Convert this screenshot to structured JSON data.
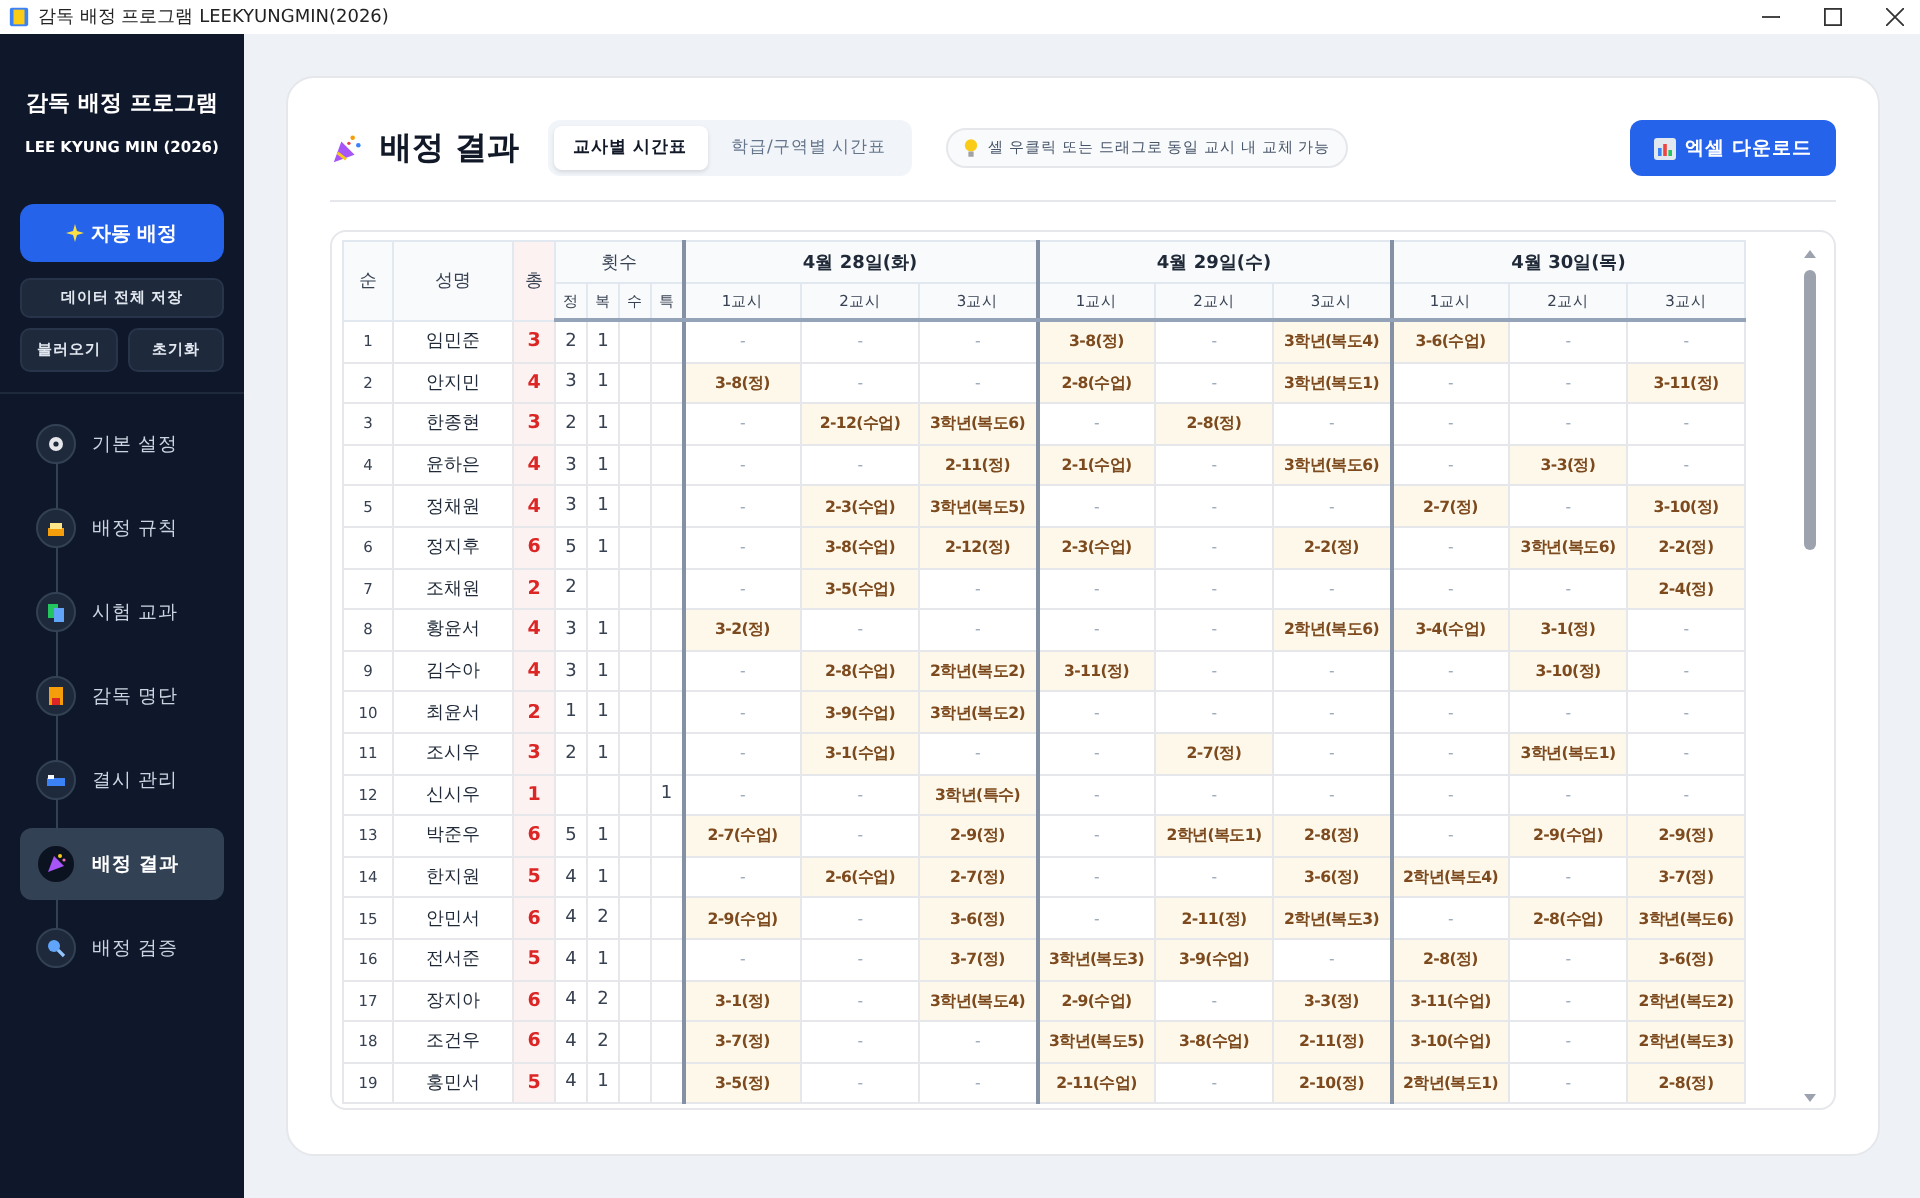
{
  "window": {
    "title": "감독 배정 프로그램 LEEKYUNGMIN(2026)"
  },
  "sidebar": {
    "title": "감독 배정 프로그램",
    "subtitle": "LEE KYUNG MIN (2026)",
    "primary_button": "자동 배정",
    "save_button": "데이터 전체 저장",
    "load_button": "불러오기",
    "reset_button": "초기화",
    "nav": [
      {
        "label": "기본 설정",
        "selected": false
      },
      {
        "label": "배정 규칙",
        "selected": false
      },
      {
        "label": "시험 교과",
        "selected": false
      },
      {
        "label": "감독 명단",
        "selected": false
      },
      {
        "label": "결시 관리",
        "selected": false
      },
      {
        "label": "배정 결과",
        "selected": true
      },
      {
        "label": "배정 검증",
        "selected": false
      }
    ]
  },
  "page": {
    "title": "배정 결과",
    "tabs": [
      {
        "label": "교사별 시간표",
        "selected": true
      },
      {
        "label": "학급/구역별 시간표",
        "selected": false
      }
    ],
    "hint": "셀 우클릭 또는 드래그로 동일 교시 내 교체 가능",
    "export_button": "엑셀 다운로드"
  },
  "table": {
    "columns": {
      "no": "순",
      "name": "성명",
      "total": "총",
      "count_group": "횟수",
      "count_types": [
        "정",
        "복",
        "수",
        "특"
      ]
    },
    "days": [
      {
        "label": "4월 28일(화)",
        "periods": [
          "1교시",
          "2교시",
          "3교시"
        ]
      },
      {
        "label": "4월 29일(수)",
        "periods": [
          "1교시",
          "2교시",
          "3교시"
        ]
      },
      {
        "label": "4월 30일(목)",
        "periods": [
          "1교시",
          "2교시",
          "3교시"
        ]
      }
    ],
    "rows": [
      {
        "no": "1",
        "name": "임민준",
        "total": "3",
        "counts": {
          "count_1": "2",
          "count_2": "1"
        },
        "cells": [
          {
            "text": "-",
            "assigned": false
          },
          {
            "text": "-",
            "assigned": false
          },
          {
            "text": "-",
            "assigned": false
          },
          {
            "text": "3-8(정)",
            "assigned": true
          },
          {
            "text": "-",
            "assigned": false
          },
          {
            "text": "3학년(복도4)",
            "assigned": true
          },
          {
            "text": "3-6(수업)",
            "assigned": true
          },
          {
            "text": "-",
            "assigned": false
          },
          {
            "text": "-",
            "assigned": false
          }
        ]
      },
      {
        "no": "2",
        "name": "안지민",
        "total": "4",
        "counts": {
          "count_1": "3",
          "count_2": "1"
        },
        "cells": [
          {
            "text": "3-8(정)",
            "assigned": true
          },
          {
            "text": "-",
            "assigned": false
          },
          {
            "text": "-",
            "assigned": false
          },
          {
            "text": "2-8(수업)",
            "assigned": true
          },
          {
            "text": "-",
            "assigned": false
          },
          {
            "text": "3학년(복도1)",
            "assigned": true
          },
          {
            "text": "-",
            "assigned": false
          },
          {
            "text": "-",
            "assigned": false
          },
          {
            "text": "3-11(정)",
            "assigned": true
          }
        ]
      },
      {
        "no": "3",
        "name": "한종현",
        "total": "3",
        "counts": {
          "count_1": "2",
          "count_2": "1"
        },
        "cells": [
          {
            "text": "-",
            "assigned": false
          },
          {
            "text": "2-12(수업)",
            "assigned": true
          },
          {
            "text": "3학년(복도6)",
            "assigned": true
          },
          {
            "text": "-",
            "assigned": false
          },
          {
            "text": "2-8(정)",
            "assigned": true
          },
          {
            "text": "-",
            "assigned": false
          },
          {
            "text": "-",
            "assigned": false
          },
          {
            "text": "-",
            "assigned": false
          },
          {
            "text": "-",
            "assigned": false
          }
        ]
      },
      {
        "no": "4",
        "name": "윤하은",
        "total": "4",
        "counts": {
          "count_1": "3",
          "count_2": "1"
        },
        "cells": [
          {
            "text": "-",
            "assigned": false
          },
          {
            "text": "-",
            "assigned": false
          },
          {
            "text": "2-11(정)",
            "assigned": true
          },
          {
            "text": "2-1(수업)",
            "assigned": true
          },
          {
            "text": "-",
            "assigned": false
          },
          {
            "text": "3학년(복도6)",
            "assigned": true
          },
          {
            "text": "-",
            "assigned": false
          },
          {
            "text": "3-3(정)",
            "assigned": true
          },
          {
            "text": "-",
            "assigned": false
          }
        ]
      },
      {
        "no": "5",
        "name": "정채원",
        "total": "4",
        "counts": {
          "count_1": "3",
          "count_2": "1"
        },
        "cells": [
          {
            "text": "-",
            "assigned": false
          },
          {
            "text": "2-3(수업)",
            "assigned": true
          },
          {
            "text": "3학년(복도5)",
            "assigned": true
          },
          {
            "text": "-",
            "assigned": false
          },
          {
            "text": "-",
            "assigned": false
          },
          {
            "text": "-",
            "assigned": false
          },
          {
            "text": "2-7(정)",
            "assigned": true
          },
          {
            "text": "-",
            "assigned": false
          },
          {
            "text": "3-10(정)",
            "assigned": true
          }
        ]
      },
      {
        "no": "6",
        "name": "정지후",
        "total": "6",
        "counts": {
          "count_1": "5",
          "count_2": "1"
        },
        "cells": [
          {
            "text": "-",
            "assigned": false
          },
          {
            "text": "3-8(수업)",
            "assigned": true
          },
          {
            "text": "2-12(정)",
            "assigned": true
          },
          {
            "text": "2-3(수업)",
            "assigned": true
          },
          {
            "text": "-",
            "assigned": false
          },
          {
            "text": "2-2(정)",
            "assigned": true
          },
          {
            "text": "-",
            "assigned": false
          },
          {
            "text": "3학년(복도6)",
            "assigned": true
          },
          {
            "text": "2-2(정)",
            "assigned": true
          }
        ]
      },
      {
        "no": "7",
        "name": "조채원",
        "total": "2",
        "counts": {
          "count_1": "2"
        },
        "cells": [
          {
            "text": "-",
            "assigned": false
          },
          {
            "text": "3-5(수업)",
            "assigned": true
          },
          {
            "text": "-",
            "assigned": false
          },
          {
            "text": "-",
            "assigned": false
          },
          {
            "text": "-",
            "assigned": false
          },
          {
            "text": "-",
            "assigned": false
          },
          {
            "text": "-",
            "assigned": false
          },
          {
            "text": "-",
            "assigned": false
          },
          {
            "text": "2-4(정)",
            "assigned": true
          }
        ]
      },
      {
        "no": "8",
        "name": "황윤서",
        "total": "4",
        "counts": {
          "count_1": "3",
          "count_2": "1"
        },
        "cells": [
          {
            "text": "3-2(정)",
            "assigned": true
          },
          {
            "text": "-",
            "assigned": false
          },
          {
            "text": "-",
            "assigned": false
          },
          {
            "text": "-",
            "assigned": false
          },
          {
            "text": "-",
            "assigned": false
          },
          {
            "text": "2학년(복도6)",
            "assigned": true
          },
          {
            "text": "3-4(수업)",
            "assigned": true
          },
          {
            "text": "3-1(정)",
            "assigned": true
          },
          {
            "text": "-",
            "assigned": false
          }
        ]
      },
      {
        "no": "9",
        "name": "김수아",
        "total": "4",
        "counts": {
          "count_1": "3",
          "count_2": "1"
        },
        "cells": [
          {
            "text": "-",
            "assigned": false
          },
          {
            "text": "2-8(수업)",
            "assigned": true
          },
          {
            "text": "2학년(복도2)",
            "assigned": true
          },
          {
            "text": "3-11(정)",
            "assigned": true
          },
          {
            "text": "-",
            "assigned": false
          },
          {
            "text": "-",
            "assigned": false
          },
          {
            "text": "-",
            "assigned": false
          },
          {
            "text": "3-10(정)",
            "assigned": true
          },
          {
            "text": "-",
            "assigned": false
          }
        ]
      },
      {
        "no": "10",
        "name": "최윤서",
        "total": "2",
        "counts": {
          "count_1": "1",
          "count_2": "1"
        },
        "cells": [
          {
            "text": "-",
            "assigned": false
          },
          {
            "text": "3-9(수업)",
            "assigned": true
          },
          {
            "text": "3학년(복도2)",
            "assigned": true
          },
          {
            "text": "-",
            "assigned": false
          },
          {
            "text": "-",
            "assigned": false
          },
          {
            "text": "-",
            "assigned": false
          },
          {
            "text": "-",
            "assigned": false
          },
          {
            "text": "-",
            "assigned": false
          },
          {
            "text": "-",
            "assigned": false
          }
        ]
      },
      {
        "no": "11",
        "name": "조시우",
        "total": "3",
        "counts": {
          "count_1": "2",
          "count_2": "1"
        },
        "cells": [
          {
            "text": "-",
            "assigned": false
          },
          {
            "text": "3-1(수업)",
            "assigned": true
          },
          {
            "text": "-",
            "assigned": false
          },
          {
            "text": "-",
            "assigned": false
          },
          {
            "text": "2-7(정)",
            "assigned": true
          },
          {
            "text": "-",
            "assigned": false
          },
          {
            "text": "-",
            "assigned": false
          },
          {
            "text": "3학년(복도1)",
            "assigned": true
          },
          {
            "text": "-",
            "assigned": false
          }
        ]
      },
      {
        "no": "12",
        "name": "신시우",
        "total": "1",
        "counts": {
          "count_4": "1"
        },
        "cells": [
          {
            "text": "-",
            "assigned": false
          },
          {
            "text": "-",
            "assigned": false
          },
          {
            "text": "3학년(특수)",
            "assigned": true
          },
          {
            "text": "-",
            "assigned": false
          },
          {
            "text": "-",
            "assigned": false
          },
          {
            "text": "-",
            "assigned": false
          },
          {
            "text": "-",
            "assigned": false
          },
          {
            "text": "-",
            "assigned": false
          },
          {
            "text": "-",
            "assigned": false
          }
        ]
      },
      {
        "no": "13",
        "name": "박준우",
        "total": "6",
        "counts": {
          "count_1": "5",
          "count_2": "1"
        },
        "cells": [
          {
            "text": "2-7(수업)",
            "assigned": true
          },
          {
            "text": "-",
            "assigned": false
          },
          {
            "text": "2-9(정)",
            "assigned": true
          },
          {
            "text": "-",
            "assigned": false
          },
          {
            "text": "2학년(복도1)",
            "assigned": true
          },
          {
            "text": "2-8(정)",
            "assigned": true
          },
          {
            "text": "-",
            "assigned": false
          },
          {
            "text": "2-9(수업)",
            "assigned": true
          },
          {
            "text": "2-9(정)",
            "assigned": true
          }
        ]
      },
      {
        "no": "14",
        "name": "한지원",
        "total": "5",
        "counts": {
          "count_1": "4",
          "count_2": "1"
        },
        "cells": [
          {
            "text": "-",
            "assigned": false
          },
          {
            "text": "2-6(수업)",
            "assigned": true
          },
          {
            "text": "2-7(정)",
            "assigned": true
          },
          {
            "text": "-",
            "assigned": false
          },
          {
            "text": "-",
            "assigned": false
          },
          {
            "text": "3-6(정)",
            "assigned": true
          },
          {
            "text": "2학년(복도4)",
            "assigned": true
          },
          {
            "text": "-",
            "assigned": false
          },
          {
            "text": "3-7(정)",
            "assigned": true
          }
        ]
      },
      {
        "no": "15",
        "name": "안민서",
        "total": "6",
        "counts": {
          "count_1": "4",
          "count_2": "2"
        },
        "cells": [
          {
            "text": "2-9(수업)",
            "assigned": true
          },
          {
            "text": "-",
            "assigned": false
          },
          {
            "text": "3-6(정)",
            "assigned": true
          },
          {
            "text": "-",
            "assigned": false
          },
          {
            "text": "2-11(정)",
            "assigned": true
          },
          {
            "text": "2학년(복도3)",
            "assigned": true
          },
          {
            "text": "-",
            "assigned": false
          },
          {
            "text": "2-8(수업)",
            "assigned": true
          },
          {
            "text": "3학년(복도6)",
            "assigned": true
          }
        ]
      },
      {
        "no": "16",
        "name": "전서준",
        "total": "5",
        "counts": {
          "count_1": "4",
          "count_2": "1"
        },
        "cells": [
          {
            "text": "-",
            "assigned": false
          },
          {
            "text": "-",
            "assigned": false
          },
          {
            "text": "3-7(정)",
            "assigned": true
          },
          {
            "text": "3학년(복도3)",
            "assigned": true
          },
          {
            "text": "3-9(수업)",
            "assigned": true
          },
          {
            "text": "-",
            "assigned": false
          },
          {
            "text": "2-8(정)",
            "assigned": true
          },
          {
            "text": "-",
            "assigned": false
          },
          {
            "text": "3-6(정)",
            "assigned": true
          }
        ]
      },
      {
        "no": "17",
        "name": "장지아",
        "total": "6",
        "counts": {
          "count_1": "4",
          "count_2": "2"
        },
        "cells": [
          {
            "text": "3-1(정)",
            "assigned": true
          },
          {
            "text": "-",
            "assigned": false
          },
          {
            "text": "3학년(복도4)",
            "assigned": true
          },
          {
            "text": "2-9(수업)",
            "assigned": true
          },
          {
            "text": "-",
            "assigned": false
          },
          {
            "text": "3-3(정)",
            "assigned": true
          },
          {
            "text": "3-11(수업)",
            "assigned": true
          },
          {
            "text": "-",
            "assigned": false
          },
          {
            "text": "2학년(복도2)",
            "assigned": true
          }
        ]
      },
      {
        "no": "18",
        "name": "조건우",
        "total": "6",
        "counts": {
          "count_1": "4",
          "count_2": "2"
        },
        "cells": [
          {
            "text": "3-7(정)",
            "assigned": true
          },
          {
            "text": "-",
            "assigned": false
          },
          {
            "text": "-",
            "assigned": false
          },
          {
            "text": "3학년(복도5)",
            "assigned": true
          },
          {
            "text": "3-8(수업)",
            "assigned": true
          },
          {
            "text": "2-11(정)",
            "assigned": true
          },
          {
            "text": "3-10(수업)",
            "assigned": true
          },
          {
            "text": "-",
            "assigned": false
          },
          {
            "text": "2학년(복도3)",
            "assigned": true
          }
        ]
      },
      {
        "no": "19",
        "name": "홍민서",
        "total": "5",
        "counts": {
          "count_1": "4",
          "count_2": "1"
        },
        "cells": [
          {
            "text": "3-5(정)",
            "assigned": true
          },
          {
            "text": "-",
            "assigned": false
          },
          {
            "text": "-",
            "assigned": false
          },
          {
            "text": "2-11(수업)",
            "assigned": true
          },
          {
            "text": "-",
            "assigned": false
          },
          {
            "text": "2-10(정)",
            "assigned": true
          },
          {
            "text": "2학년(복도1)",
            "assigned": true
          },
          {
            "text": "-",
            "assigned": false
          },
          {
            "text": "2-8(정)",
            "assigned": true
          }
        ]
      }
    ]
  }
}
